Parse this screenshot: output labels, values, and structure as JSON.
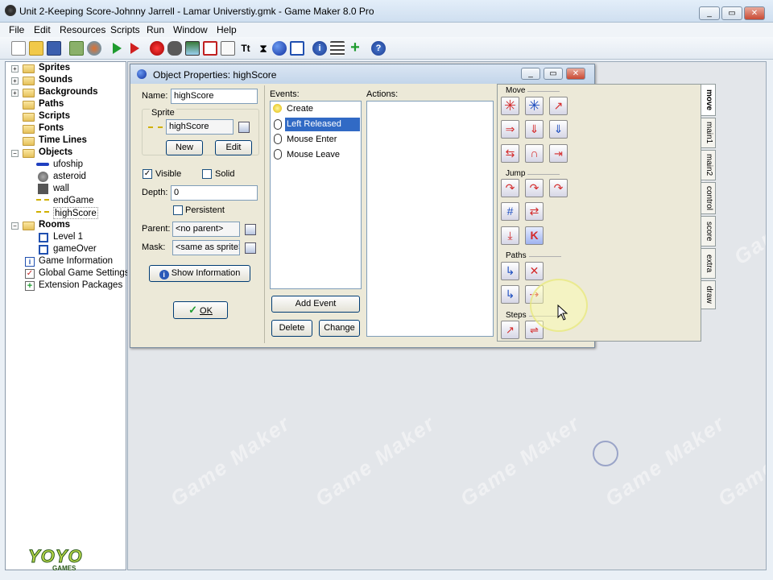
{
  "window": {
    "title": "Unit 2-Keeping Score-Johnny Jarrell - Lamar Universtiy.gmk - Game Maker 8.0 Pro",
    "controls": {
      "minimize": "_",
      "restore": "▭",
      "close": "✕"
    }
  },
  "menu": [
    "File",
    "Edit",
    "Resources",
    "Scripts",
    "Run",
    "Window",
    "Help"
  ],
  "toolbar_icons": [
    "new-file-icon",
    "open-file-icon",
    "save-icon",
    "create-executable-icon",
    "publish-icon",
    "run-icon",
    "debug-run-icon",
    "add-sprite-icon",
    "add-sound-icon",
    "add-background-icon",
    "add-path-icon",
    "add-script-icon",
    "add-font-icon",
    "add-timeline-icon",
    "add-object-icon",
    "add-room-icon",
    "game-info-icon",
    "global-settings-icon",
    "extension-packages-icon",
    "help-icon"
  ],
  "tree": {
    "sprites": "Sprites",
    "sounds": "Sounds",
    "backgrounds": "Backgrounds",
    "paths": "Paths",
    "scripts": "Scripts",
    "fonts": "Fonts",
    "timelines": "Time Lines",
    "objects": "Objects",
    "object_items": [
      "ufoship",
      "asteroid",
      "wall",
      "endGame",
      "highScore"
    ],
    "rooms": "Rooms",
    "room_items": [
      "Level 1",
      "gameOver"
    ],
    "game_info": "Game Information",
    "global_settings": "Global Game Settings",
    "extension_packages": "Extension Packages"
  },
  "logo": {
    "line1": "YOYO",
    "line2": "GAMES"
  },
  "watermark": "Game Maker",
  "dialog": {
    "title": "Object Properties: highScore",
    "name_label": "Name:",
    "name_value": "highScore",
    "sprite_label": "Sprite",
    "sprite_value": "highScore",
    "new_label": "New",
    "edit_label": "Edit",
    "visible_label": "Visible",
    "visible_checked": true,
    "solid_label": "Solid",
    "solid_checked": false,
    "depth_label": "Depth:",
    "depth_value": "0",
    "persistent_label": "Persistent",
    "persistent_checked": false,
    "parent_label": "Parent:",
    "parent_value": "<no parent>",
    "mask_label": "Mask:",
    "mask_value": "<same as sprite>",
    "show_info_label": "Show Information",
    "ok_label": "OK",
    "events_label": "Events:",
    "events": [
      "Create",
      "Left Released",
      "Mouse Enter",
      "Mouse Leave"
    ],
    "selected_event": 1,
    "actions_label": "Actions:",
    "add_event_label": "Add Event",
    "delete_label": "Delete",
    "change_label": "Change",
    "groups": {
      "move": "Move",
      "jump": "Jump",
      "paths": "Paths",
      "steps": "Steps"
    },
    "tabs": [
      "move",
      "main1",
      "main2",
      "control",
      "score",
      "extra",
      "draw"
    ]
  },
  "colors": {
    "selection": "#316ac5",
    "dialog_bg": "#ece9d8",
    "action_red": "#d42a2a",
    "action_blue": "#2050c0"
  }
}
